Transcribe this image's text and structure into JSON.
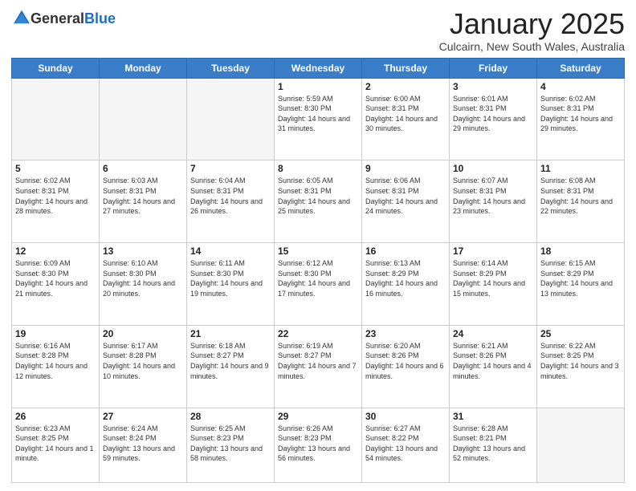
{
  "logo": {
    "general": "General",
    "blue": "Blue"
  },
  "header": {
    "month": "January 2025",
    "location": "Culcairn, New South Wales, Australia"
  },
  "weekdays": [
    "Sunday",
    "Monday",
    "Tuesday",
    "Wednesday",
    "Thursday",
    "Friday",
    "Saturday"
  ],
  "weeks": [
    [
      {
        "day": "",
        "sunrise": "",
        "sunset": "",
        "daylight": ""
      },
      {
        "day": "",
        "sunrise": "",
        "sunset": "",
        "daylight": ""
      },
      {
        "day": "",
        "sunrise": "",
        "sunset": "",
        "daylight": ""
      },
      {
        "day": "1",
        "sunrise": "5:59 AM",
        "sunset": "8:30 PM",
        "daylight": "14 hours and 31 minutes."
      },
      {
        "day": "2",
        "sunrise": "6:00 AM",
        "sunset": "8:31 PM",
        "daylight": "14 hours and 30 minutes."
      },
      {
        "day": "3",
        "sunrise": "6:01 AM",
        "sunset": "8:31 PM",
        "daylight": "14 hours and 29 minutes."
      },
      {
        "day": "4",
        "sunrise": "6:02 AM",
        "sunset": "8:31 PM",
        "daylight": "14 hours and 29 minutes."
      }
    ],
    [
      {
        "day": "5",
        "sunrise": "6:02 AM",
        "sunset": "8:31 PM",
        "daylight": "14 hours and 28 minutes."
      },
      {
        "day": "6",
        "sunrise": "6:03 AM",
        "sunset": "8:31 PM",
        "daylight": "14 hours and 27 minutes."
      },
      {
        "day": "7",
        "sunrise": "6:04 AM",
        "sunset": "8:31 PM",
        "daylight": "14 hours and 26 minutes."
      },
      {
        "day": "8",
        "sunrise": "6:05 AM",
        "sunset": "8:31 PM",
        "daylight": "14 hours and 25 minutes."
      },
      {
        "day": "9",
        "sunrise": "6:06 AM",
        "sunset": "8:31 PM",
        "daylight": "14 hours and 24 minutes."
      },
      {
        "day": "10",
        "sunrise": "6:07 AM",
        "sunset": "8:31 PM",
        "daylight": "14 hours and 23 minutes."
      },
      {
        "day": "11",
        "sunrise": "6:08 AM",
        "sunset": "8:31 PM",
        "daylight": "14 hours and 22 minutes."
      }
    ],
    [
      {
        "day": "12",
        "sunrise": "6:09 AM",
        "sunset": "8:30 PM",
        "daylight": "14 hours and 21 minutes."
      },
      {
        "day": "13",
        "sunrise": "6:10 AM",
        "sunset": "8:30 PM",
        "daylight": "14 hours and 20 minutes."
      },
      {
        "day": "14",
        "sunrise": "6:11 AM",
        "sunset": "8:30 PM",
        "daylight": "14 hours and 19 minutes."
      },
      {
        "day": "15",
        "sunrise": "6:12 AM",
        "sunset": "8:30 PM",
        "daylight": "14 hours and 17 minutes."
      },
      {
        "day": "16",
        "sunrise": "6:13 AM",
        "sunset": "8:29 PM",
        "daylight": "14 hours and 16 minutes."
      },
      {
        "day": "17",
        "sunrise": "6:14 AM",
        "sunset": "8:29 PM",
        "daylight": "14 hours and 15 minutes."
      },
      {
        "day": "18",
        "sunrise": "6:15 AM",
        "sunset": "8:29 PM",
        "daylight": "14 hours and 13 minutes."
      }
    ],
    [
      {
        "day": "19",
        "sunrise": "6:16 AM",
        "sunset": "8:28 PM",
        "daylight": "14 hours and 12 minutes."
      },
      {
        "day": "20",
        "sunrise": "6:17 AM",
        "sunset": "8:28 PM",
        "daylight": "14 hours and 10 minutes."
      },
      {
        "day": "21",
        "sunrise": "6:18 AM",
        "sunset": "8:27 PM",
        "daylight": "14 hours and 9 minutes."
      },
      {
        "day": "22",
        "sunrise": "6:19 AM",
        "sunset": "8:27 PM",
        "daylight": "14 hours and 7 minutes."
      },
      {
        "day": "23",
        "sunrise": "6:20 AM",
        "sunset": "8:26 PM",
        "daylight": "14 hours and 6 minutes."
      },
      {
        "day": "24",
        "sunrise": "6:21 AM",
        "sunset": "8:26 PM",
        "daylight": "14 hours and 4 minutes."
      },
      {
        "day": "25",
        "sunrise": "6:22 AM",
        "sunset": "8:25 PM",
        "daylight": "14 hours and 3 minutes."
      }
    ],
    [
      {
        "day": "26",
        "sunrise": "6:23 AM",
        "sunset": "8:25 PM",
        "daylight": "14 hours and 1 minute."
      },
      {
        "day": "27",
        "sunrise": "6:24 AM",
        "sunset": "8:24 PM",
        "daylight": "13 hours and 59 minutes."
      },
      {
        "day": "28",
        "sunrise": "6:25 AM",
        "sunset": "8:23 PM",
        "daylight": "13 hours and 58 minutes."
      },
      {
        "day": "29",
        "sunrise": "6:26 AM",
        "sunset": "8:23 PM",
        "daylight": "13 hours and 56 minutes."
      },
      {
        "day": "30",
        "sunrise": "6:27 AM",
        "sunset": "8:22 PM",
        "daylight": "13 hours and 54 minutes."
      },
      {
        "day": "31",
        "sunrise": "6:28 AM",
        "sunset": "8:21 PM",
        "daylight": "13 hours and 52 minutes."
      },
      {
        "day": "",
        "sunrise": "",
        "sunset": "",
        "daylight": ""
      }
    ]
  ],
  "labels": {
    "sunrise": "Sunrise:",
    "sunset": "Sunset:",
    "daylight": "Daylight:"
  }
}
